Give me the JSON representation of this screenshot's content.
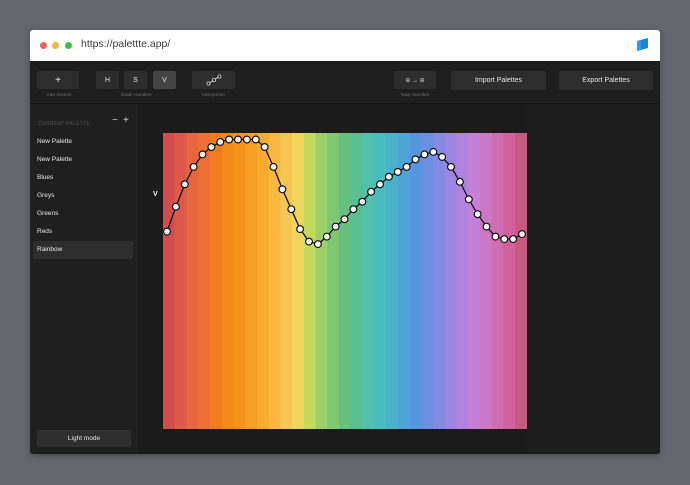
{
  "browser": {
    "url": "https://palettte.app/"
  },
  "toolbar": {
    "add_search_icon": "+",
    "add_search_label": "Add Search",
    "scale_handles": [
      {
        "label": "H",
        "active": false
      },
      {
        "label": "S",
        "active": false
      },
      {
        "label": "V",
        "active": true
      }
    ],
    "scale_handles_label": "Scale Handles",
    "interpolate_label": "Interpolate",
    "map_handles_icon": "⊖ → ⊖",
    "map_handles_label": "Map Handles",
    "import_label": "Import Palettes",
    "export_label": "Export Palettes"
  },
  "sidebar": {
    "header": "CURRENT PALETTE",
    "minus": "−",
    "plus": "+",
    "palettes": [
      {
        "label": "New Palette",
        "selected": false
      },
      {
        "label": "New Palette",
        "selected": false
      },
      {
        "label": "Blues",
        "selected": false
      },
      {
        "label": "Greys",
        "selected": false
      },
      {
        "label": "Greens",
        "selected": false
      },
      {
        "label": "Reds",
        "selected": false
      },
      {
        "label": "Rainbow",
        "selected": true
      }
    ],
    "light_mode_label": "Light mode"
  },
  "editor": {
    "channel_label": "V",
    "swatches": [
      "#d04e4c",
      "#de5948",
      "#e86540",
      "#ee7034",
      "#f27d21",
      "#f58818",
      "#f7931d",
      "#f99e25",
      "#fbab30",
      "#fbb841",
      "#f6c653",
      "#eed65e",
      "#c5d95f",
      "#9bd166",
      "#7dc870",
      "#66c17e",
      "#58bf92",
      "#4fc1ac",
      "#4abcbf",
      "#4bb1cb",
      "#4ea4d6",
      "#5596df",
      "#6a8ee2",
      "#8489e3",
      "#9a85e2",
      "#b282df",
      "#c47fd8",
      "#cd78c6",
      "#cf6db0",
      "#d0619a",
      "#c9587f"
    ],
    "curve_values": [
      0.62,
      0.72,
      0.81,
      0.88,
      0.93,
      0.96,
      0.98,
      0.99,
      0.99,
      0.99,
      0.99,
      0.96,
      0.88,
      0.79,
      0.71,
      0.63,
      0.58,
      0.57,
      0.6,
      0.64,
      0.67,
      0.71,
      0.74,
      0.78,
      0.81,
      0.84,
      0.86,
      0.88,
      0.91,
      0.93,
      0.94,
      0.92,
      0.88,
      0.82,
      0.75,
      0.69,
      0.64,
      0.6,
      0.59,
      0.59,
      0.61
    ]
  }
}
